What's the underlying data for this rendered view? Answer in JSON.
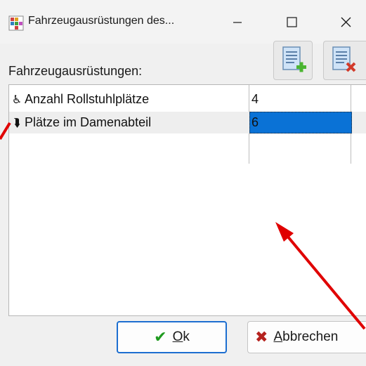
{
  "window": {
    "title": "Fahrzeugausrüstungen des..."
  },
  "section_label": "Fahrzeugausrüstungen:",
  "toolbar": {
    "add_icon": "add-document-icon",
    "delete_icon": "delete-document-icon"
  },
  "equipment_rows": [
    {
      "icon": "wheelchair-icon",
      "name": "Anzahl Rollstuhlplätze",
      "value": "4"
    },
    {
      "icon": "female-seat-icon",
      "name": "Plätze im Damenabteil",
      "value": "6"
    }
  ],
  "buttons": {
    "ok_label": "Ok",
    "cancel_label": "Abbrechen"
  },
  "colors": {
    "selection": "#0a72d6",
    "ok_border": "#1c6ed0",
    "annotation_arrow": "#e00000"
  }
}
